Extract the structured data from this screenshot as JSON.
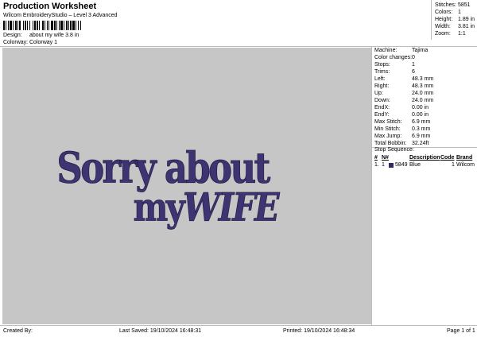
{
  "header": {
    "title": "Production Worksheet",
    "subtitle": "Wilcom EmbroideryStudio – Level 3 Advanced",
    "design_label": "Design:",
    "design_value": "about my wife 3.8 in",
    "colorway_label": "Colorway:",
    "colorway_value": "Colorway 1"
  },
  "summary": {
    "stitches_label": "Stitches:",
    "stitches_value": "5851",
    "colors_label": "Colors:",
    "colors_value": "1",
    "height_label": "Height:",
    "height_value": "1.89 in",
    "width_label": "Width:",
    "width_value": "3.81 in",
    "zoom_label": "Zoom:",
    "zoom_value": "1:1"
  },
  "design_text": {
    "line1": "Sorry about",
    "line2a": "my",
    "line2b": "WIFE",
    "thread_color": "#3d3471"
  },
  "machine": {
    "rows": [
      {
        "label": "Machine:",
        "value": "Tajima"
      },
      {
        "label": "Color changes:",
        "value": "0"
      },
      {
        "label": "Stops:",
        "value": "1"
      },
      {
        "label": "Trims:",
        "value": "6"
      },
      {
        "label": "Left:",
        "value": "48.3 mm"
      },
      {
        "label": "Right:",
        "value": "48.3 mm"
      },
      {
        "label": "Up:",
        "value": "24.0 mm"
      },
      {
        "label": "Down:",
        "value": "24.0 mm"
      },
      {
        "label": "EndX:",
        "value": "0.00 in"
      },
      {
        "label": "EndY:",
        "value": "0.00 in"
      },
      {
        "label": "Max Stitch:",
        "value": "6.9 mm"
      },
      {
        "label": "Min Stitch:",
        "value": "0.3 mm"
      },
      {
        "label": "Max Jump:",
        "value": "6.9 mm"
      },
      {
        "label": "Total Bobbin:",
        "value": "32.24ft"
      }
    ]
  },
  "stop_sequence": {
    "label": "Stop Sequence:",
    "headers": [
      "#",
      "N#",
      "",
      "Description",
      "Code",
      "Brand"
    ],
    "rows": [
      {
        "num": "1.",
        "n": "1",
        "stitches": "5849",
        "description": "Blue",
        "code": "1",
        "brand": "Wilcom",
        "color": "#2b2a6b"
      }
    ]
  },
  "footer": {
    "created_by": "Created By:",
    "last_saved": "Last Saved: 19/10/2024 16:48:31",
    "printed": "Printed: 19/10/2024 16:48:34",
    "page": "Page 1 of 1"
  }
}
